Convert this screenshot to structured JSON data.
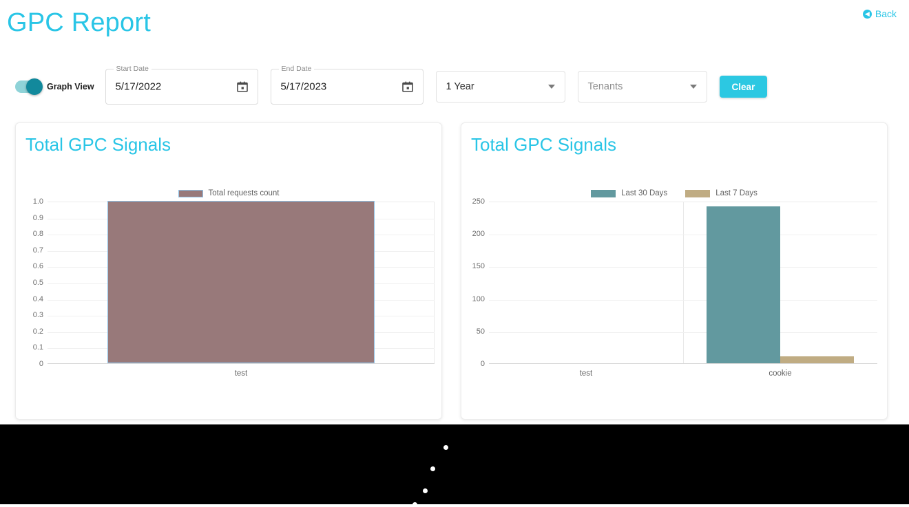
{
  "header": {
    "title": "GPC Report",
    "back_label": "Back",
    "back_icon": "circle-left-arrow-icon",
    "accent_color": "#29c5e6"
  },
  "toolbar": {
    "toggle": {
      "label": "Graph View",
      "state": "on"
    },
    "start_date": {
      "legend": "Start Date",
      "value": "5/17/2022",
      "icon": "calendar-icon"
    },
    "end_date": {
      "legend": "End Date",
      "value": "5/17/2023",
      "icon": "calendar-icon"
    },
    "range_select": {
      "value": "1 Year",
      "icon": "chevron-down-icon"
    },
    "tenants_select": {
      "placeholder": "Tenants",
      "icon": "chevron-down-icon"
    },
    "clear_label": "Clear",
    "clear_color": "#2cc8e2"
  },
  "cards": {
    "left": {
      "title": "Total GPC Signals"
    },
    "right": {
      "title": "Total GPC Signals"
    }
  },
  "chart_data": [
    {
      "type": "bar",
      "title": "Total GPC Signals",
      "categories": [
        "test"
      ],
      "series": [
        {
          "name": "Total requests count",
          "values": [
            1.0
          ],
          "color": "#98797a",
          "border_color": "#90c3e8"
        }
      ],
      "yticks": [
        "1.0",
        "0.9",
        "0.8",
        "0.7",
        "0.6",
        "0.5",
        "0.4",
        "0.3",
        "0.2",
        "0.1",
        "0"
      ],
      "ylim": [
        0,
        1.0
      ],
      "xlabel": "",
      "ylabel": "",
      "grid": true,
      "legend_position": "top"
    },
    {
      "type": "bar",
      "title": "Total GPC Signals",
      "categories": [
        "test",
        "cookie"
      ],
      "series": [
        {
          "name": "Last 30 Days",
          "values": [
            0,
            242
          ],
          "color": "#62999f"
        },
        {
          "name": "Last 7 Days",
          "values": [
            0,
            11
          ],
          "color": "#c0ac83"
        }
      ],
      "yticks": [
        "250",
        "200",
        "150",
        "100",
        "50",
        "0"
      ],
      "ylim": [
        0,
        250
      ],
      "xlabel": "",
      "ylabel": "",
      "grid": true,
      "legend_position": "top"
    }
  ],
  "overlay": {
    "loading_dots": 4
  }
}
